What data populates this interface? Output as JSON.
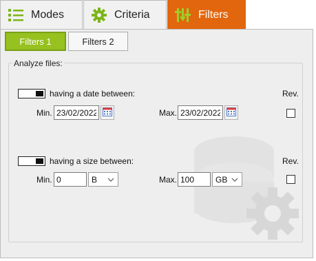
{
  "tabs": {
    "modes": "Modes",
    "criteria": "Criteria",
    "filters": "Filters"
  },
  "subtabs": {
    "filters1": "Filters 1",
    "filters2": "Filters 2"
  },
  "group_title": "Analyze files:",
  "date_filter": {
    "label": "having a date between:",
    "rev_label": "Rev.",
    "min_label": "Min.",
    "min_value": "23/02/2022",
    "max_label": "Max.",
    "max_value": "23/02/2022"
  },
  "size_filter": {
    "label": "having a size between:",
    "rev_label": "Rev.",
    "min_label": "Min.",
    "min_value": "0",
    "min_unit": "B",
    "max_label": "Max.",
    "max_value": "100",
    "max_unit": "GB"
  },
  "colors": {
    "active_tab": "#e2660d",
    "active_subtab": "#96c11f",
    "icon_green": "#7cb518"
  }
}
